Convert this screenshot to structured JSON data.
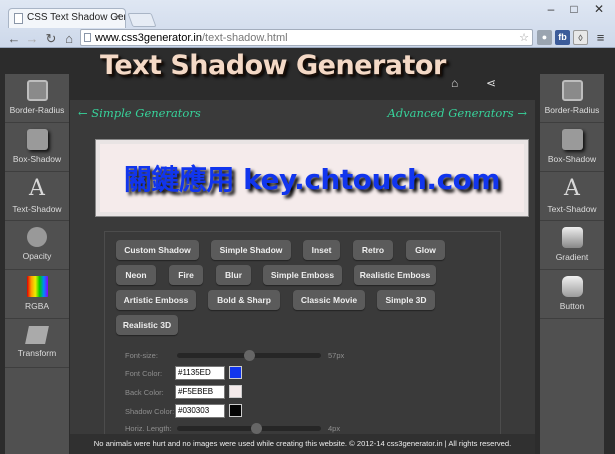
{
  "browser": {
    "tab_title": "CSS Text Shadow Gener",
    "url_domain": "www.css3generator.in",
    "url_path": "/text-shadow.html",
    "extension_1": "fb"
  },
  "page": {
    "title": "Text Shadow Generator",
    "simple_generators_link": "← Simple Generators",
    "advanced_generators_link": "Advanced Generators →",
    "preview_text": "關鍵應用 key.chtouch.com",
    "footer": "No animals were hurt and no images were used while creating this website. © 2012-14 css3generator.in | All rights reserved."
  },
  "left_sidebar": [
    {
      "label": "Border-Radius",
      "icon": "border-radius-icon"
    },
    {
      "label": "Box-Shadow",
      "icon": "box-shadow-icon"
    },
    {
      "label": "Text-Shadow",
      "icon": "text-shadow-icon"
    },
    {
      "label": "Opacity",
      "icon": "opacity-icon"
    },
    {
      "label": "RGBA",
      "icon": "rgba-icon"
    },
    {
      "label": "Transform",
      "icon": "transform-icon"
    }
  ],
  "right_sidebar": [
    {
      "label": "Border-Radius",
      "icon": "border-radius-icon"
    },
    {
      "label": "Box-Shadow",
      "icon": "box-shadow-icon"
    },
    {
      "label": "Text-Shadow",
      "icon": "text-shadow-icon"
    },
    {
      "label": "Gradient",
      "icon": "gradient-icon"
    },
    {
      "label": "Button",
      "icon": "button-icon"
    }
  ],
  "presets": [
    "Custom Shadow",
    "Simple Shadow",
    "Inset",
    "Retro",
    "Glow",
    "Neon",
    "Fire",
    "Blur",
    "Simple Emboss",
    "Realistic Emboss",
    "Artistic Emboss",
    "Bold & Sharp",
    "Classic Movie",
    "Simple 3D",
    "Realistic 3D"
  ],
  "params": {
    "font_size": {
      "label": "Font-size:",
      "value": "57px",
      "level": 0.5
    },
    "font_color": {
      "label": "Font Color:",
      "value": "#1135ED",
      "color": "#1135ED"
    },
    "back_color": {
      "label": "Back Color:",
      "value": "#F5EBEB",
      "color": "#F5EBEB"
    },
    "shadow_color": {
      "label": "Shadow Color:",
      "value": "#030303",
      "color": "#030303"
    },
    "horiz_length": {
      "label": "Horiz. Length:",
      "value": "4px",
      "level": 0.55
    }
  },
  "colors": {
    "accent_link": "#37d39b",
    "sidebar_bg": "#505050",
    "chip_bg": "#5b5b5b"
  }
}
